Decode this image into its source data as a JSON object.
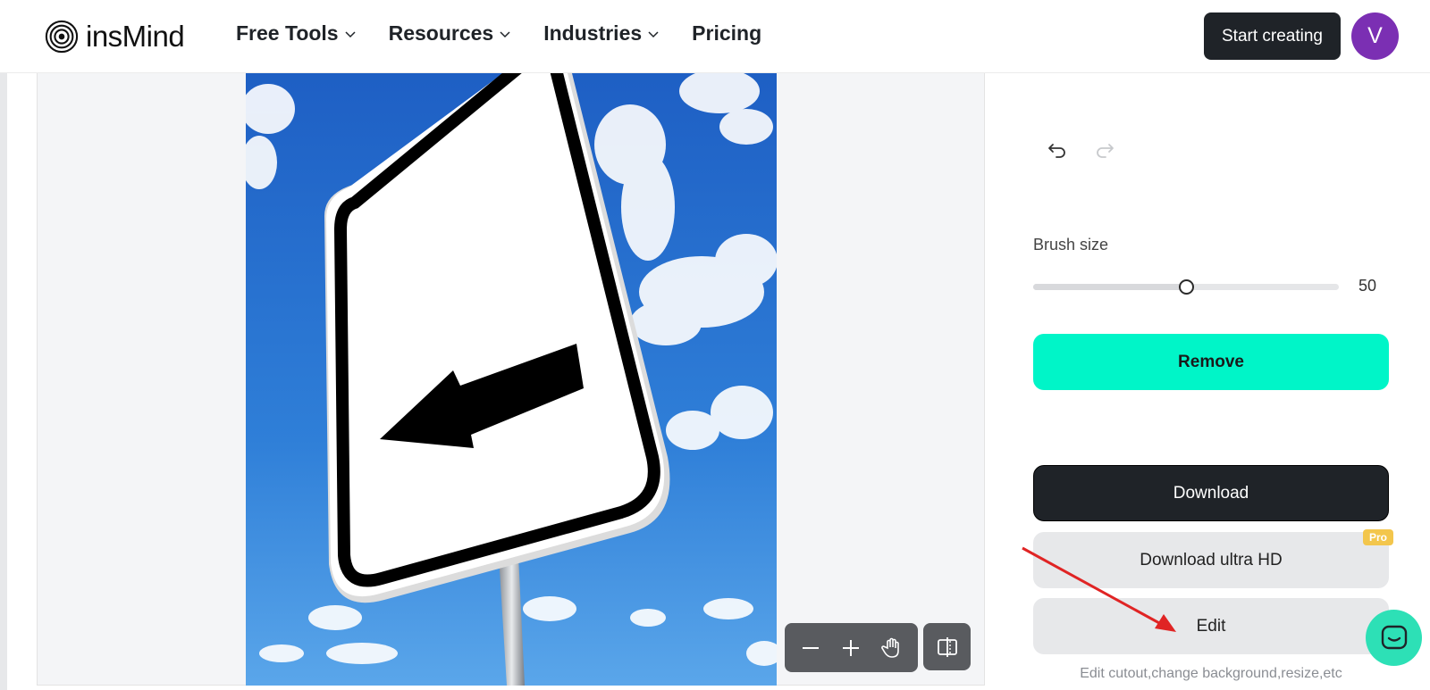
{
  "brand": {
    "name": "insMind"
  },
  "nav": {
    "items": [
      {
        "label": "Free Tools",
        "has_dropdown": true
      },
      {
        "label": "Resources",
        "has_dropdown": true
      },
      {
        "label": "Industries",
        "has_dropdown": true
      },
      {
        "label": "Pricing",
        "has_dropdown": false
      }
    ]
  },
  "header": {
    "start_label": "Start creating",
    "avatar_initial": "V"
  },
  "toolbar": {
    "undo_icon": "undo-icon",
    "redo_icon": "redo-icon"
  },
  "brush": {
    "label": "Brush size",
    "value": "50",
    "level_fraction": 0.5
  },
  "actions": {
    "remove_label": "Remove",
    "download_label": "Download",
    "download_ultra_label": "Download ultra HD",
    "pro_badge": "Pro",
    "edit_label": "Edit",
    "edit_hint": "Edit cutout,change background,resize,etc"
  },
  "canvas_controls": {
    "zoom_out_icon": "minus-icon",
    "zoom_in_icon": "plus-icon",
    "pan_icon": "hand-icon",
    "compare_icon": "compare-icon"
  },
  "colors": {
    "accent": "#00f5c8",
    "dark": "#1f2328",
    "avatar": "#7b2fb3",
    "chat": "#2de0b6",
    "pro": "#f3c64c",
    "annotation": "#e02424"
  }
}
